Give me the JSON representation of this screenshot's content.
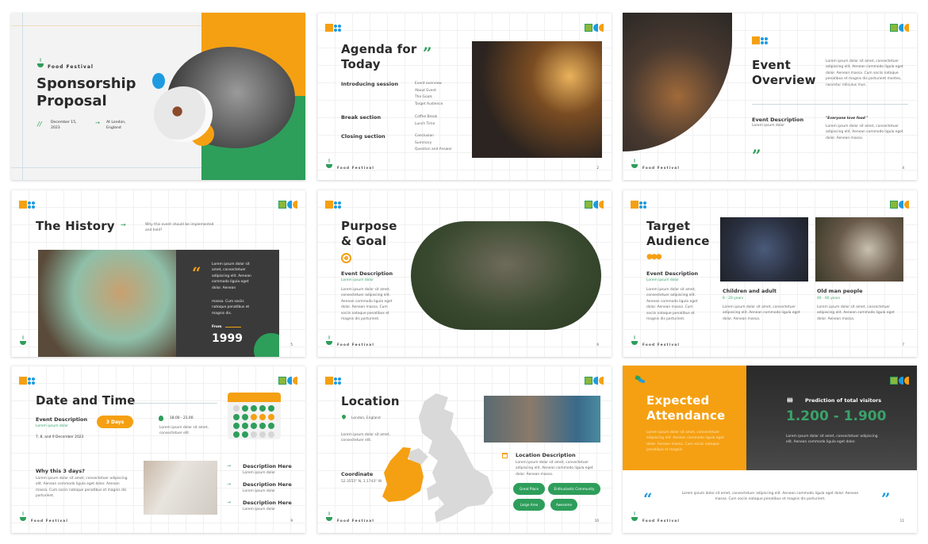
{
  "brand": "Food Festival",
  "colors": {
    "orange": "#F5A012",
    "green": "#2E9E5B",
    "blue": "#1E9BE0",
    "dark": "#333333"
  },
  "icons": [
    "food-bowl-icon",
    "quote-icon",
    "arrow-right-icon",
    "target-icon",
    "people-icon",
    "clock-icon",
    "calendar-icon",
    "location-pin-icon",
    "visitors-icon"
  ],
  "slides": [
    {
      "title_line1": "Sponsorship",
      "title_line2": "Proposal",
      "date": "December 15, 2023",
      "location": "At London, England",
      "separator": "//"
    },
    {
      "title_line1": "Agenda for",
      "title_line2": "Today",
      "page": "2",
      "sections": [
        {
          "label": "Introducing session",
          "items": [
            "Event overview",
            "About Event",
            "The Goals",
            "Target Audience"
          ]
        },
        {
          "label": "Break section",
          "items": [
            "Coffee Break",
            "Lunch Time"
          ]
        },
        {
          "label": "Closing section",
          "items": [
            "Conclusion",
            "Summary",
            "Question and Answer"
          ]
        }
      ]
    },
    {
      "title_line1": "Event",
      "title_line2": "Overview",
      "page": "4",
      "intro": "Lorem ipsum dolor sit amet, consectetuer adipiscing elit. Aenean commodo ligula eget dolor. Aenean massa. Cum sociis natoque penatibus et magnis dis parturient montes, nascetur ridiculus mus.",
      "desc_title": "Event Description",
      "desc_sub": "Lorem ipsum dolor",
      "quote": "\"Everyone love food \"",
      "quote_text": "Lorem ipsum dolor sit amet, consectetuer adipiscing elit. Aenean commodo ligula eget dolor. Aenean massa."
    },
    {
      "title": "The History",
      "page": "5",
      "question": "Why this event should be implemented and held?",
      "quote_text1": "Lorem ipsum dolor sit amet, consectetuer adipiscing elit. Aenean commodo ligula eget dolor. Aenean",
      "quote_text2": "massa. Cum sociis natoque penatibus et magnis dis.",
      "from_label": "From",
      "year": "1999"
    },
    {
      "title_line1": "Purpose",
      "title_line2": "& Goal",
      "page": "6",
      "desc_title": "Event Description",
      "desc_sub": "Lorem ipsum dolor",
      "text": "Lorem ipsum dolor sit amet, consectetuer adipiscing elit. Aenean commodo ligula eget dolor. Aenean massa. Cum sociis natoque penatibus et magnis dis parturient."
    },
    {
      "title_line1": "Target",
      "title_line2": "Audience",
      "page": "7",
      "desc_title": "Event Description",
      "desc_sub": "Lorem ipsum dolor",
      "text": "Lorem ipsum dolor sit amet, consectetuer adipiscing elit. Aenean commodo ligula eget dolor. Aenean massa. Cum sociis natoque penatibus et magnis dis parturient.",
      "groups": [
        {
          "name": "Children and adult",
          "ages": "8 - 20 years",
          "text": "Lorem ipsum dolor sit amet, consectetuer adipiscing elit. Aenean commodo ligula eget dolor. Aenean massa."
        },
        {
          "name": "Old man people",
          "ages": "40 - 60 years",
          "text": "Lorem ipsum dolor sit amet, consectetuer adipiscing elit. Aenean commodo ligula eget dolor. Aenean massa."
        }
      ]
    },
    {
      "title": "Date and Time",
      "page": "9",
      "desc_title": "Event Description",
      "desc_sub": "Lorem ipsum dolor",
      "dates": "7, 8, and 9 December 2023",
      "days_badge": "3 Days",
      "time": "18.00 - 21.00",
      "time_text": "Lorem ipsum dolor sit amet, consectetuer elit.",
      "why_title": "Why this 3 days?",
      "why_text": "Lorem ipsum dolor sit amet, consectetuer adipiscing elit. Aenean commodo ligula eget dolor. Aenean massa. Cum sociis natoque penatibus et magnis dis parturient.",
      "items": [
        {
          "title": "Description Here",
          "sub": "Lorem ipsum dolor"
        },
        {
          "title": "Description Here",
          "sub": "Lorem ipsum dolor"
        },
        {
          "title": "Description Here",
          "sub": "Lorem ipsum dolor"
        }
      ]
    },
    {
      "title": "Location",
      "page": "10",
      "place": "London, England",
      "text": "Lorem ipsum dolor sit amet, consectetuer elit.",
      "coord_title": "Coordinate",
      "coord": "52.3555° N, 1.1743° W",
      "desc_title": "Location Description",
      "desc_text": "Lorem ipsum dolor sit amet, consectetuer adipiscing elit. Aenean commodo ligula eget dolor. Aenean massa.",
      "tags": [
        "Great Place",
        "Enthusiastic Community",
        "Large Area",
        "Awesome"
      ]
    },
    {
      "title_line1": "Expected",
      "title_line2": "Attendance",
      "page": "11",
      "text": "Lorem ipsum dolor sit amet, consectetuer adipiscing elit. Aenean commodo ligula eget dolor. Aenean massa. Cum sociis natoque penatibus et magnis.",
      "prediction_label": "Prediction of total visitors",
      "prediction": "1.200 - 1.900",
      "prediction_text": "Lorem ipsum dolor sit amet, consectetuer adipiscing elit. Aenean commodo ligula eget dolor.",
      "quote_text": "Lorem ipsum dolor sit amet, consectetuer adipiscing elit. Aenean commodo ligula eget dolor. Aenean massa. Cum sociis natoque penatibus et magnis dis parturient."
    }
  ]
}
